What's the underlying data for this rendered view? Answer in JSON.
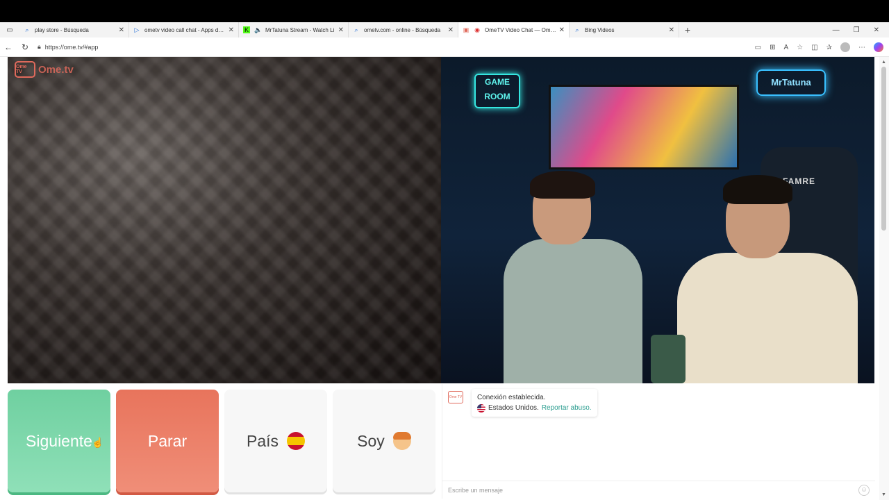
{
  "browser": {
    "tabs": [
      {
        "title": "play store - Búsqueda",
        "icon": "search-icon"
      },
      {
        "title": "ometv video call chat - Apps de A",
        "icon": "play-store-icon"
      },
      {
        "title": "MrTatuna Stream - Watch Li",
        "icon": "kick-icon"
      },
      {
        "title": "ometv.com - online - Búsqueda",
        "icon": "search-icon"
      },
      {
        "title": "OmeTV Video Chat — Omeg",
        "icon": "ometv-icon",
        "active": true
      },
      {
        "title": "Bing Videos",
        "icon": "search-icon"
      }
    ],
    "url": "https://ome.tv/#app"
  },
  "app": {
    "logo_box": "Ome TV",
    "logo_text": "Ome.tv",
    "remote_video": {
      "neon_left": "GAME ROOM",
      "neon_right": "MrTatuna",
      "chair_brand": "FAMRE"
    },
    "buttons": {
      "next": "Siguiente",
      "stop": "Parar",
      "country": "País",
      "gender": "Soy"
    },
    "chat": {
      "status_line": "Conexión establecida.",
      "country_line": "Estados Unidos.",
      "report_link": "Reportar abuso.",
      "input_placeholder": "Escribe un mensaje"
    }
  },
  "colors": {
    "next": "#6fd0a0",
    "stop": "#e8745c",
    "brand": "#e06a5c",
    "link": "#2a9d8f"
  }
}
